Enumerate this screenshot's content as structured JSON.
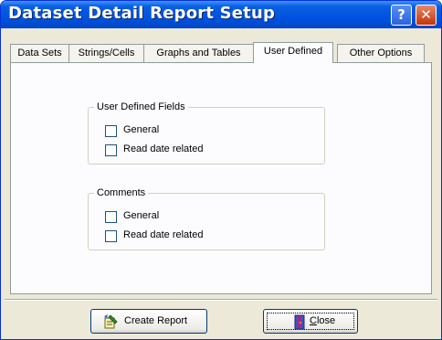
{
  "window": {
    "title": "Dataset Detail Report Setup",
    "help_glyph": "?",
    "close_glyph": "✕"
  },
  "tabs": [
    {
      "label": "Data Sets"
    },
    {
      "label": "Strings/Cells"
    },
    {
      "label": "Graphs and Tables"
    },
    {
      "label": "User Defined",
      "active": true
    },
    {
      "label": "Other Options"
    }
  ],
  "groups": {
    "user_defined_fields": {
      "legend": "User Defined Fields",
      "options": [
        {
          "label": "General",
          "checked": false
        },
        {
          "label": "Read date related",
          "checked": false
        }
      ]
    },
    "comments": {
      "legend": "Comments",
      "options": [
        {
          "label": "General",
          "checked": false
        },
        {
          "label": "Read date related",
          "checked": false
        }
      ]
    }
  },
  "buttons": {
    "create_report": {
      "label": "Create Report",
      "icon": "report-icon"
    },
    "close": {
      "label": "Close",
      "accesskey": "C",
      "icon": "door-icon"
    }
  }
}
